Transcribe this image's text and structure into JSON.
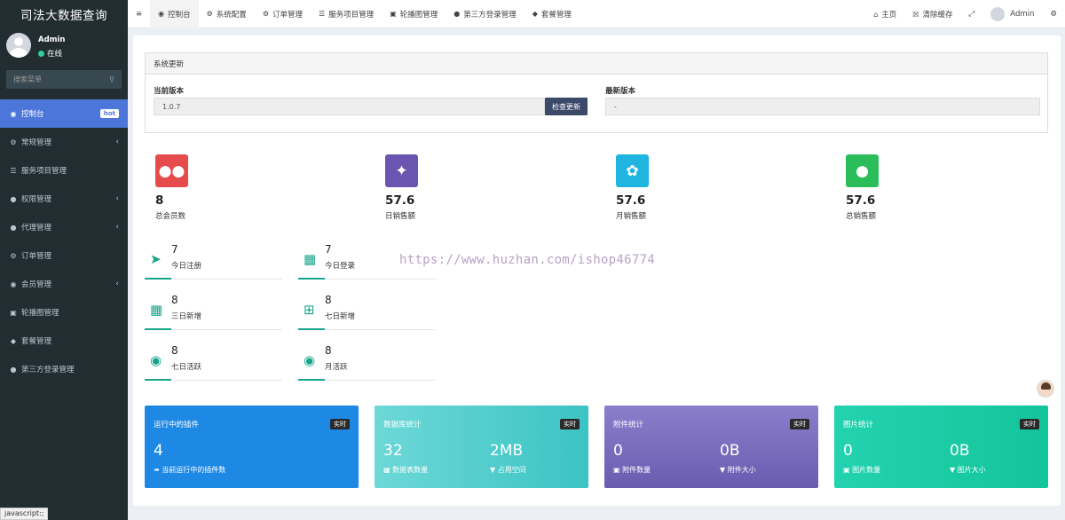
{
  "app": {
    "title": "司法大数据查询"
  },
  "user": {
    "name": "Admin",
    "status": "在线"
  },
  "sidebar": {
    "search_placeholder": "搜索菜单",
    "items": [
      {
        "label": "控制台",
        "icon": "dashboard-icon",
        "badge": "hot",
        "active": true
      },
      {
        "label": "常规管理",
        "icon": "cogs-icon",
        "arrow": "‹"
      },
      {
        "label": "服务项目管理",
        "icon": "list-icon"
      },
      {
        "label": "权限管理",
        "icon": "group-icon",
        "arrow": "‹"
      },
      {
        "label": "代理管理",
        "icon": "group-icon",
        "arrow": "‹"
      },
      {
        "label": "订单管理",
        "icon": "gear-icon"
      },
      {
        "label": "会员管理",
        "icon": "user-circle-icon",
        "arrow": "‹"
      },
      {
        "label": "轮播图管理",
        "icon": "image-icon"
      },
      {
        "label": "套餐管理",
        "icon": "cube-icon"
      },
      {
        "label": "第三方登录管理",
        "icon": "group-icon"
      }
    ]
  },
  "topbar": {
    "menu_icon": "≡",
    "tabs": [
      {
        "label": "控制台",
        "icon": "dashboard-icon",
        "active": true
      },
      {
        "label": "系统配置",
        "icon": "gear-icon"
      },
      {
        "label": "订单管理",
        "icon": "gear-icon"
      },
      {
        "label": "服务项目管理",
        "icon": "list-icon"
      },
      {
        "label": "轮播图管理",
        "icon": "image-icon"
      },
      {
        "label": "第三方登录管理",
        "icon": "group-icon"
      },
      {
        "label": "套餐管理",
        "icon": "cube-icon"
      }
    ],
    "home_label": "主页",
    "clear_cache_label": "清除缓存",
    "user_label": "Admin"
  },
  "update_panel": {
    "title": "系统更新",
    "current_label": "当前版本",
    "current_value": "1.0.7",
    "check_button": "检查更新",
    "latest_label": "最新版本",
    "latest_value": "-"
  },
  "stats": [
    {
      "value": "8",
      "label": "总会员数",
      "color": "#e74c4c",
      "icon": "users-icon"
    },
    {
      "value": "57.6",
      "label": "日销售额",
      "color": "#6a55b0",
      "icon": "magic-icon"
    },
    {
      "value": "57.6",
      "label": "月销售额",
      "color": "#1fb5e0",
      "icon": "leaf-icon"
    },
    {
      "value": "57.6",
      "label": "总销售额",
      "color": "#2bbd5a",
      "icon": "user-icon"
    }
  ],
  "mini_stats": [
    {
      "value": "7",
      "label": "今日注册",
      "icon": "rocket-icon"
    },
    {
      "value": "7",
      "label": "今日登录",
      "icon": "id-card-icon"
    },
    {
      "value": "8",
      "label": "三日新增",
      "icon": "calendar-icon"
    },
    {
      "value": "8",
      "label": "七日新增",
      "icon": "calendar-plus-icon"
    },
    {
      "value": "8",
      "label": "七日活跃",
      "icon": "user-circle-icon"
    },
    {
      "value": "8",
      "label": "月活跃",
      "icon": "user-circle-icon"
    }
  ],
  "watermark": "https://www.huzhan.com/ishop46774",
  "cards": [
    {
      "title": "运行中的插件",
      "badge": "实时",
      "v1": "4",
      "s1": "当前运行中的插件数",
      "v2": "",
      "s2": "",
      "bg": "linear-gradient(#1e88e5,#1e88e5)"
    },
    {
      "title": "数据库统计",
      "badge": "实时",
      "v1": "32",
      "s1": "数据表数量",
      "v2": "2MB",
      "s2": "占用空间",
      "bg": "linear-gradient(90deg,#5fd3d3,#3cc3c3)"
    },
    {
      "title": "附件统计",
      "badge": "实时",
      "v1": "0",
      "s1": "附件数量",
      "v2": "0B",
      "s2": "附件大小",
      "bg": "linear-gradient(#8a7fcb,#6a5bb0)"
    },
    {
      "title": "图片统计",
      "badge": "实时",
      "v1": "0",
      "s1": "图片数量",
      "v2": "0B",
      "s2": "图片大小",
      "bg": "linear-gradient(90deg,#23d3b0,#13c49a)"
    }
  ],
  "statusbar": "javascript:;"
}
